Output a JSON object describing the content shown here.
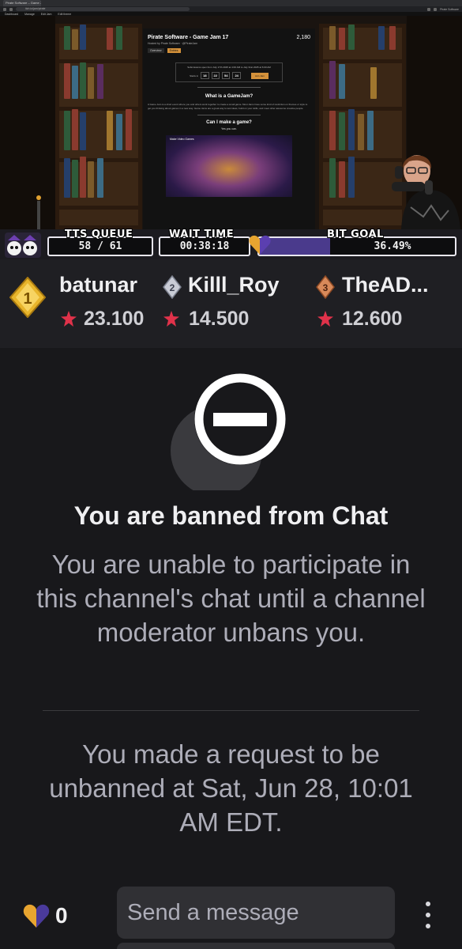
{
  "browser": {
    "tab_title": "Pirate Software – Game Jam 17",
    "url": "itch.io/jam/pirate",
    "bookmarks": [
      "Dashboard",
      "Manage",
      "Edit Jam",
      "Edit theme"
    ],
    "profile": "Pirate Software"
  },
  "game_jam_page": {
    "title": "Pirate Software - Game Jam 17",
    "host": "Hosted by Pirate Software · @PirateJam",
    "entries_count": "2,180",
    "tabs": [
      "Overview",
      "Entries"
    ],
    "submission_text": "Submissions open from July 17th 2025 at 4:00 AM to July 31st 2025 at 6:00 AM",
    "countdown": [
      {
        "value": "18",
        "unit": "days"
      },
      {
        "value": "22",
        "unit": "hours"
      },
      {
        "value": "54",
        "unit": "minutes"
      },
      {
        "value": "24",
        "unit": "seconds"
      }
    ],
    "starts_in_label": "Starts in",
    "join_button": "Join Jam",
    "what_heading": "What is a GameJam?",
    "what_text": "A Game Jam is a short event where you and others work together to create a small game. Most Jams have some kind of restriction on themes or style to get you thinking about games in a new way. Game Jams are a great way to test ideas, build on your skills, and meet other awesome creative people.",
    "can_heading": "Can I make a game?",
    "can_answer": "Yes you can.",
    "video_title": "Make Video Games"
  },
  "overlay": {
    "tts_queue": {
      "label": "TTS QUEUE",
      "value": "58 / 61"
    },
    "wait_time": {
      "label": "WAIT TIME",
      "value": "00:38:18"
    },
    "bit_goal": {
      "label": "BIT GOAL",
      "value": "36.49%",
      "progress": 0.3649
    }
  },
  "leaderboard": [
    {
      "rank": "1",
      "name": "batunar",
      "score": "23.100"
    },
    {
      "rank": "2",
      "name": "Killl_Roy",
      "score": "14.500"
    },
    {
      "rank": "3",
      "name": "TheAD...",
      "score": "12.600"
    }
  ],
  "chat_ban": {
    "icon": "ban-icon",
    "title": "You are banned from Chat",
    "body": "You are unable to participate in this channel's chat until a channel moderator unbans you.",
    "request_status": "You made a request to be unbanned at Sat, Jun 28, 10:01 AM EDT."
  },
  "chat_input": {
    "bits_icon": "bits-heart-icon",
    "bits_count": "0",
    "placeholder": "Send a message",
    "more_icon": "vertical-dots-icon"
  },
  "colors": {
    "background": "#18181b",
    "leaderboard_bg": "#1f1f23",
    "muted_text": "#adadb8",
    "bit_fill": "#4a3a8c",
    "gold": "#e8b52b",
    "star_red": "#e0324a"
  }
}
